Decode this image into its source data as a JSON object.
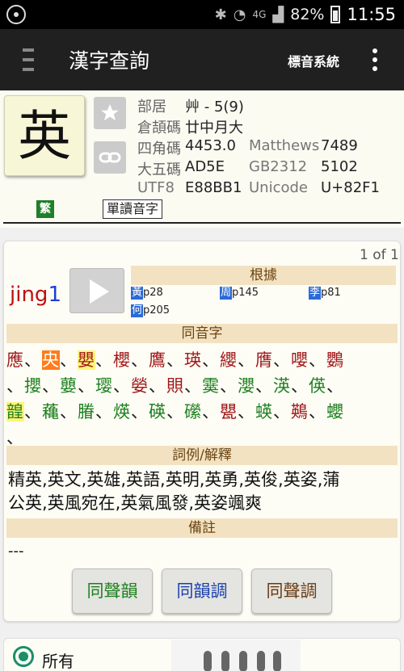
{
  "status_bar": {
    "battery": "82%",
    "time": "11:55",
    "network": "4G"
  },
  "app_bar": {
    "title": "漢字查詢",
    "tone_system": "標音系統"
  },
  "character": {
    "glyph": "英",
    "radical_label": "部居",
    "radical_value": "艸 - 5(9)",
    "cangjie_label": "倉頡碼",
    "cangjie_value": "廿中月大",
    "four_corner_label": "四角碼",
    "four_corner_value": "4453.0",
    "matthews_label": "Matthews",
    "matthews_value": "7489",
    "big5_label": "大五碼",
    "big5_value": "AD5E",
    "gb_label": "GB2312",
    "gb_value": "5102",
    "utf8_label": "UTF8",
    "utf8_value": "E88BB1",
    "unicode_label": "Unicode",
    "unicode_value": "U+82F1",
    "trad_badge": "繁",
    "single_read_label": "單讀音字"
  },
  "reading": {
    "page_indicator": "1 of 1",
    "pinyin_syllable": "jing",
    "pinyin_tone": "1",
    "basis_header": "根據",
    "refs": [
      {
        "tag": "黃",
        "page": "p28"
      },
      {
        "tag": "周",
        "page": "p145"
      },
      {
        "tag": "李",
        "page": "p81"
      },
      {
        "tag": "何",
        "page": "p205"
      }
    ],
    "homophones_header": "同音字",
    "homophones_row1": [
      "應",
      "央",
      "嬰",
      "櫻",
      "鷹",
      "瑛",
      "纓",
      "膺",
      "嚶",
      "鸚"
    ],
    "homophones_row2": [
      "攖",
      "蘡",
      "璎",
      "嫈",
      "賏",
      "霙",
      "瀴",
      "渶",
      "偀"
    ],
    "homophones_row3": [
      "韹",
      "蘒",
      "膡",
      "煐",
      "碤",
      "礯",
      "甖",
      "蝧",
      "鶧",
      "蠳"
    ],
    "trailing_comma": "、",
    "separator": "、",
    "explain_header": "詞例/解釋",
    "explain_line1": "精英,英文,英雄,英語,英明,英勇,英俊,英姿,蒲",
    "explain_line2": "公英,英風宛在,英氣風發,英姿颯爽",
    "notes_header": "備註",
    "notes_value": "---",
    "btn_same_initial_final": "同聲韻",
    "btn_same_final_tone": "同韻調",
    "btn_same_initial_tone": "同聲調"
  },
  "filter": {
    "all_label": "所有"
  },
  "colors": {
    "accent_green": "#1c7f1c",
    "accent_red": "#a01818",
    "header_bg": "#f3e2c1",
    "ref_tag": "#2a6ad8"
  }
}
